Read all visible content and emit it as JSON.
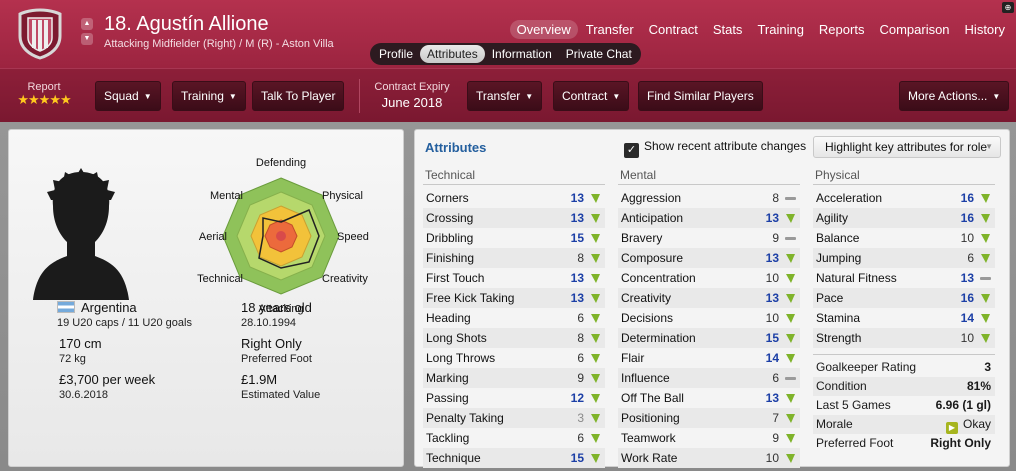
{
  "header": {
    "player_name": "18. Agustín Allione",
    "position_line": "Attacking Midfielder (Right) / M (R) - Aston Villa",
    "main_tabs": [
      "Overview",
      "Transfer",
      "Contract",
      "Stats",
      "Training",
      "Reports",
      "Comparison",
      "History"
    ],
    "sub_tabs": [
      "Profile",
      "Attributes",
      "Information",
      "Private Chat"
    ]
  },
  "toolbar": {
    "report_label": "Report",
    "stars": "★★★★★",
    "squad": "Squad",
    "training": "Training",
    "talk": "Talk To Player",
    "contract_expiry_label": "Contract Expiry",
    "contract_expiry_value": "June 2018",
    "transfer": "Transfer",
    "contract": "Contract",
    "similar": "Find Similar Players",
    "more": "More Actions..."
  },
  "radar": {
    "labels": [
      "Defending",
      "Physical",
      "Speed",
      "Creativity",
      "Attacking",
      "Technical",
      "Aerial",
      "Mental"
    ]
  },
  "profile": {
    "nationality": "Argentina",
    "caps": "19 U20 caps / 11 U20 goals",
    "age": "18 years old",
    "dob": "28.10.1994",
    "height": "170 cm",
    "weight": "72 kg",
    "foot": "Right Only",
    "foot_label": "Preferred Foot",
    "wage": "£3,700 per week",
    "wage_until": "30.6.2018",
    "value": "£1.9M",
    "value_label": "Estimated Value"
  },
  "attributes": {
    "title": "Attributes",
    "show_changes_label": "Show recent attribute changes",
    "highlight_label": "Highlight key attributes for role",
    "technical_head": "Technical",
    "mental_head": "Mental",
    "physical_head": "Physical",
    "technical": [
      {
        "name": "Corners",
        "value": "13",
        "trend": "up"
      },
      {
        "name": "Crossing",
        "value": "13",
        "trend": "up"
      },
      {
        "name": "Dribbling",
        "value": "15",
        "trend": "up"
      },
      {
        "name": "Finishing",
        "value": "8",
        "trend": "up"
      },
      {
        "name": "First Touch",
        "value": "13",
        "trend": "up"
      },
      {
        "name": "Free Kick Taking",
        "value": "13",
        "trend": "up"
      },
      {
        "name": "Heading",
        "value": "6",
        "trend": "up"
      },
      {
        "name": "Long Shots",
        "value": "8",
        "trend": "up"
      },
      {
        "name": "Long Throws",
        "value": "6",
        "trend": "up"
      },
      {
        "name": "Marking",
        "value": "9",
        "trend": "up"
      },
      {
        "name": "Passing",
        "value": "12",
        "trend": "up"
      },
      {
        "name": "Penalty Taking",
        "value": "3",
        "trend": "up"
      },
      {
        "name": "Tackling",
        "value": "6",
        "trend": "up"
      },
      {
        "name": "Technique",
        "value": "15",
        "trend": "up"
      }
    ],
    "mental": [
      {
        "name": "Aggression",
        "value": "8",
        "trend": "flat"
      },
      {
        "name": "Anticipation",
        "value": "13",
        "trend": "up"
      },
      {
        "name": "Bravery",
        "value": "9",
        "trend": "flat"
      },
      {
        "name": "Composure",
        "value": "13",
        "trend": "up"
      },
      {
        "name": "Concentration",
        "value": "10",
        "trend": "up"
      },
      {
        "name": "Creativity",
        "value": "13",
        "trend": "up"
      },
      {
        "name": "Decisions",
        "value": "10",
        "trend": "up"
      },
      {
        "name": "Determination",
        "value": "15",
        "trend": "up"
      },
      {
        "name": "Flair",
        "value": "14",
        "trend": "up"
      },
      {
        "name": "Influence",
        "value": "6",
        "trend": "flat"
      },
      {
        "name": "Off The Ball",
        "value": "13",
        "trend": "up"
      },
      {
        "name": "Positioning",
        "value": "7",
        "trend": "up"
      },
      {
        "name": "Teamwork",
        "value": "9",
        "trend": "up"
      },
      {
        "name": "Work Rate",
        "value": "10",
        "trend": "up"
      }
    ],
    "physical": [
      {
        "name": "Acceleration",
        "value": "16",
        "trend": "up"
      },
      {
        "name": "Agility",
        "value": "16",
        "trend": "up"
      },
      {
        "name": "Balance",
        "value": "10",
        "trend": "up"
      },
      {
        "name": "Jumping",
        "value": "6",
        "trend": "up"
      },
      {
        "name": "Natural Fitness",
        "value": "13",
        "trend": "flat"
      },
      {
        "name": "Pace",
        "value": "16",
        "trend": "up"
      },
      {
        "name": "Stamina",
        "value": "14",
        "trend": "up"
      },
      {
        "name": "Strength",
        "value": "10",
        "trend": "up"
      }
    ],
    "summary": [
      {
        "name": "Goalkeeper Rating",
        "value": "3"
      },
      {
        "name": "Condition",
        "value": "81%"
      },
      {
        "name": "Last 5 Games",
        "value": "6.96 (1 gl)"
      },
      {
        "name": "Morale",
        "value": "Okay"
      },
      {
        "name": "Preferred Foot",
        "value": "Right Only"
      }
    ]
  },
  "colors": {
    "header": "#b4314e",
    "toolbar": "#8d1f39",
    "attr_high": "#1c3fa6",
    "trend_up": "#7fb32a",
    "star": "#ffc81e"
  }
}
